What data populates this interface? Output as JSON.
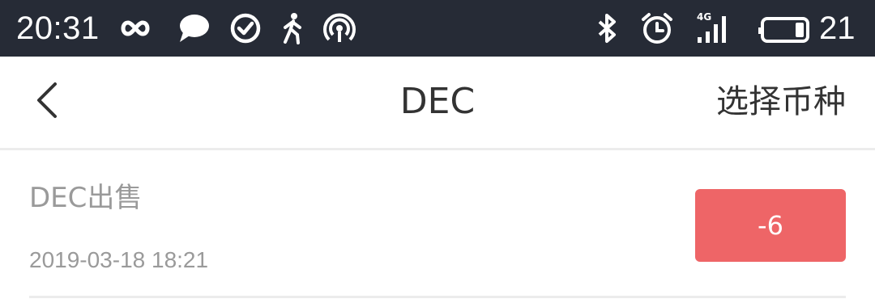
{
  "status_bar": {
    "time": "20:31",
    "battery_percent": "21",
    "network_label": "4G",
    "icons": [
      "loop-icon",
      "chat-bubble-icon",
      "check-circle-icon",
      "walking-icon",
      "hotspot-icon",
      "bluetooth-icon",
      "alarm-icon",
      "signal-4g-icon",
      "battery-icon"
    ]
  },
  "nav": {
    "title": "DEC",
    "action_label": "选择币种",
    "back_icon": "chevron-left-icon"
  },
  "records": [
    {
      "title": "DEC出售",
      "time": "2019-03-18 18:21",
      "amount": "-6"
    }
  ],
  "colors": {
    "status_bar_bg": "#262b36",
    "amount_badge": "#ee6567",
    "secondary_text": "#9a9a9a",
    "primary_text": "#333333",
    "divider": "#ececec"
  }
}
